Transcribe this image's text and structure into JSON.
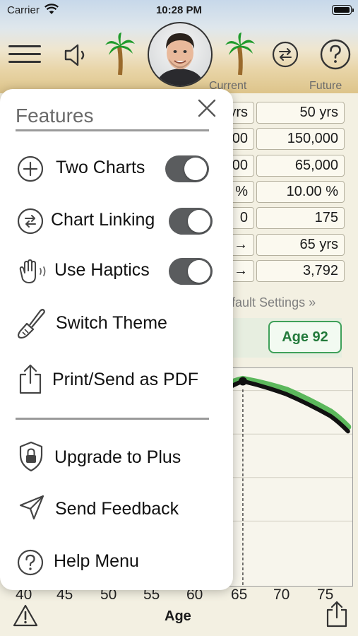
{
  "status_bar": {
    "carrier": "Carrier",
    "time": "10:28 PM"
  },
  "header": {
    "current_label": "Current",
    "future_label": "Future"
  },
  "background_fields": [
    {
      "left_partial": "yrs",
      "value": "50 yrs"
    },
    {
      "left_partial": "00",
      "value": "150,000"
    },
    {
      "left_partial": "00",
      "value": "65,000"
    },
    {
      "left_partial": "%",
      "value": "10.00 %"
    },
    {
      "left_partial": "0",
      "value": "175"
    },
    {
      "left_partial": "→",
      "value": "65 yrs"
    },
    {
      "left_partial": "→",
      "value": "3,792"
    }
  ],
  "settings_link": "efault Settings »",
  "age_badge": "Age 92",
  "chart_data": {
    "type": "line",
    "xlabel": "Age",
    "x_ticks": [
      "40",
      "45",
      "50",
      "55",
      "60",
      "65",
      "70",
      "75"
    ],
    "series": [
      {
        "color": "#5cb85c",
        "x": [
          63,
          65,
          70,
          75,
          77
        ],
        "y": [
          0.92,
          0.95,
          0.9,
          0.8,
          0.73
        ]
      },
      {
        "color": "#111111",
        "x": [
          63,
          65,
          70,
          75,
          77
        ],
        "y": [
          0.9,
          0.94,
          0.88,
          0.78,
          0.71
        ]
      }
    ],
    "marker_age": 65,
    "grid": true
  },
  "menu": {
    "title": "Features",
    "items": [
      {
        "icon": "plus-circle-icon",
        "label": "Two Charts",
        "toggle": true
      },
      {
        "icon": "link-arrows-icon",
        "label": "Chart Linking",
        "toggle": true
      },
      {
        "icon": "hand-haptics-icon",
        "label": "Use Haptics",
        "toggle": true
      },
      {
        "icon": "paintbrush-icon",
        "label": "Switch Theme"
      },
      {
        "icon": "share-icon",
        "label": "Print/Send as PDF"
      },
      {
        "icon": "shield-lock-icon",
        "label": "Upgrade to Plus"
      },
      {
        "icon": "paper-plane-icon",
        "label": "Send Feedback"
      },
      {
        "icon": "question-circle-icon",
        "label": "Help Menu"
      }
    ]
  },
  "colors": {
    "toggle_on": "#5a5c5e",
    "badge_green": "#3fa05a",
    "chart_green": "#5cb85c"
  }
}
